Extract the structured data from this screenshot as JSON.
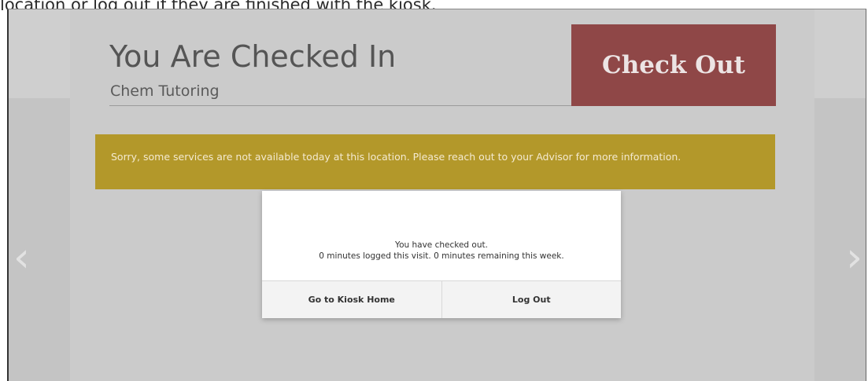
{
  "caption": "location or log out if they are finished with the kiosk.",
  "header": {
    "title": "You Are Checked In",
    "subtitle": "Chem Tutoring",
    "checkout_label": "Check Out"
  },
  "alert": {
    "message": "Sorry, some services are not available today at this location. Please reach out to your Advisor for more information."
  },
  "modal": {
    "line1": "You have checked out.",
    "line2": "0 minutes logged this visit. 0 minutes remaining this week.",
    "kiosk_home_label": "Go to Kiosk Home",
    "logout_label": "Log Out"
  },
  "nav": {
    "prev_glyph": "‹",
    "next_glyph": "›"
  },
  "colors": {
    "checkout": "#8f4747",
    "alert": "#b3982a",
    "overlay": "#cbcbcb"
  }
}
